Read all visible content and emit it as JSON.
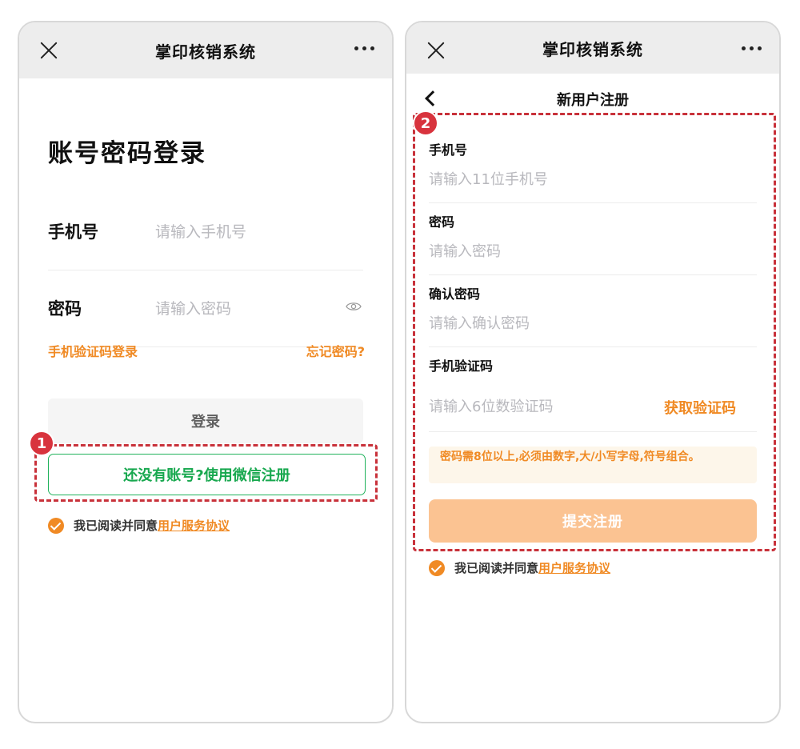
{
  "app_title": "掌印核销系统",
  "left": {
    "page_title": "账号密码登录",
    "phone": {
      "label": "手机号",
      "placeholder": "请输入手机号"
    },
    "password": {
      "label": "密码",
      "placeholder": "请输入密码"
    },
    "sms_login_link": "手机验证码登录",
    "forgot_password_link": "忘记密码?",
    "login_button": "登录",
    "register_button": "还没有账号?使用微信注册",
    "badge": "1",
    "agreement_prefix": "我已阅读并同意",
    "agreement_link": "用户服务协议"
  },
  "right": {
    "page_title": "新用户注册",
    "badge": "2",
    "fields": [
      {
        "label": "手机号",
        "placeholder": "请输入11位手机号"
      },
      {
        "label": "密码",
        "placeholder": "请输入密码"
      },
      {
        "label": "确认密码",
        "placeholder": "请输入确认密码"
      },
      {
        "label": "手机验证码",
        "placeholder": "请输入6位数验证码"
      }
    ],
    "get_code_button": "获取验证码",
    "hint": "密码需8位以上,必须由数字,大/小写字母,符号组合。",
    "submit_button": "提交注册",
    "agreement_prefix": "我已阅读并同意",
    "agreement_link": "用户服务协议"
  },
  "colors": {
    "accent_orange": "#f08a24",
    "accent_green": "#18a84f",
    "annotation_red": "#c8313a",
    "submit_disabled": "#fbc392"
  }
}
